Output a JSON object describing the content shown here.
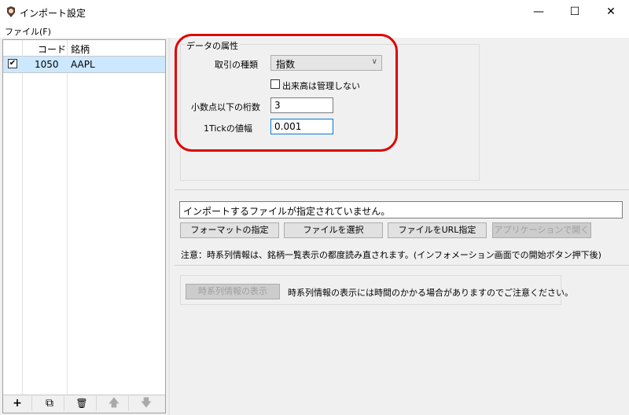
{
  "window": {
    "title": "インポート設定",
    "minimize": "—",
    "maximize": "☐",
    "close": "✕"
  },
  "menu": {
    "file": "ファイル(F)"
  },
  "grid": {
    "headers": [
      "",
      "コード",
      "銘柄"
    ],
    "rows": [
      {
        "checked": "✔",
        "code": "1050",
        "name": "AAPL"
      }
    ]
  },
  "toolbar": {
    "add": "+",
    "copy": "⧉",
    "delete": "🗑",
    "up": "🡅",
    "down": "🡇"
  },
  "attributes": {
    "group_title": "データの属性",
    "trade_type_label": "取引の種類",
    "trade_type_value": "指数",
    "no_volume_label": "出来高は管理しない",
    "decimals_label": "小数点以下の桁数",
    "decimals_value": "3",
    "tick_label": "1Tickの値幅",
    "tick_value": "0.001"
  },
  "import": {
    "status": "インポートするファイルが指定されていません。",
    "format_btn": "フォーマットの指定",
    "select_file_btn": "ファイルを選択",
    "url_btn": "ファイルをURL指定",
    "open_app_btn": "アプリケーションで開く",
    "note": "注意：時系列情報は、銘柄一覧表示の都度読み直されます。(インフォメーション画面での開始ボタン押下後)"
  },
  "history": {
    "show_btn": "時系列情報の表示",
    "note": "時系列情報の表示には時間のかかる場合がありますのでご注意ください。"
  },
  "colors": {
    "highlight": "#e00000",
    "selected_row": "#cce8ff"
  }
}
